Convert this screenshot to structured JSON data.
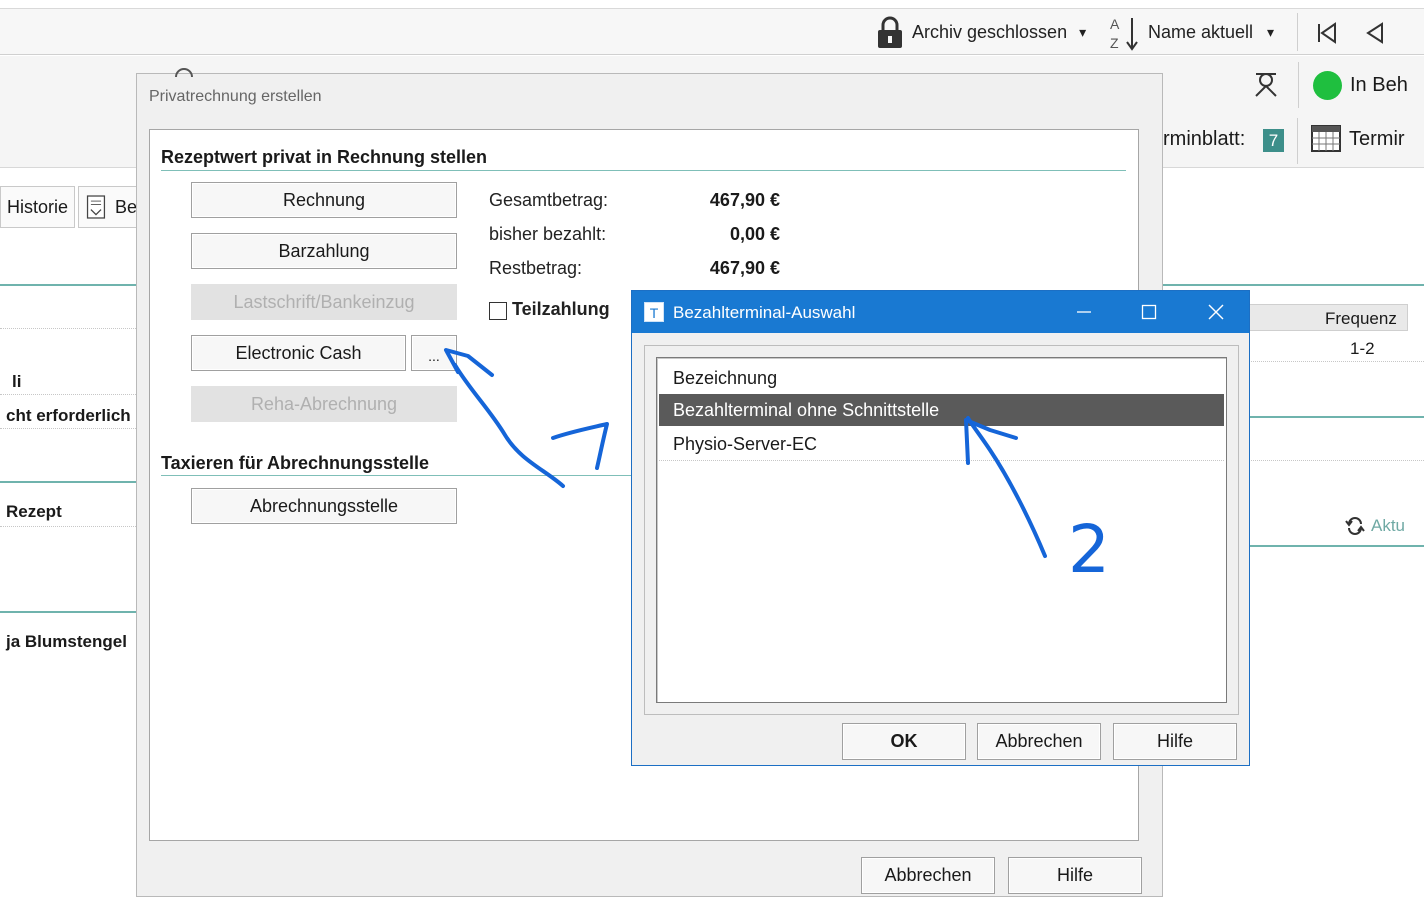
{
  "topbar": {
    "archive_label": "Archiv geschlossen",
    "sort_label": "Name aktuell",
    "caret": "▾"
  },
  "status": {
    "in_treatment": "In Beh",
    "appointment_sheet": "rminblatt:",
    "appointment_day": "7",
    "appointment_label": "Termir"
  },
  "background": {
    "tab_history": "Historie",
    "tab_b": "Be",
    "text_li": "li",
    "text_required": "cht erforderlich",
    "text_rezept": "Rezept",
    "text_blumstengel": "ja Blumstengel",
    "col_frequency": "Frequenz",
    "frequency_value": "1-2",
    "refresh_label": "Aktu"
  },
  "dialog": {
    "title": "Privatrechnung erstellen",
    "section1_title": "Rezeptwert privat in Rechnung stellen",
    "btn_invoice": "Rechnung",
    "btn_cash": "Barzahlung",
    "btn_debit": "Lastschrift/Bankeinzug",
    "btn_ec": "Electronic Cash",
    "btn_more": "...",
    "btn_reha": "Reha-Abrechnung",
    "total_label": "Gesamtbetrag:",
    "total_value": "467,90 €",
    "paid_label": "bisher bezahlt:",
    "paid_value": "0,00 €",
    "rest_label": "Restbetrag:",
    "rest_value": "467,90 €",
    "partial_label": "Teilzahlung",
    "section2_title": "Taxieren für Abrechnungsstelle",
    "btn_billing_office": "Abrechnungsstelle",
    "btn_cancel": "Abbrechen",
    "btn_help": "Hilfe"
  },
  "terminal_dialog": {
    "title": "Bezahlterminal-Auswahl",
    "app_icon_letter": "T",
    "column_header": "Bezeichnung",
    "items": [
      {
        "label": "Bezahlterminal ohne Schnittstelle",
        "selected": true
      },
      {
        "label": "Physio-Server-EC",
        "selected": false
      }
    ],
    "btn_ok": "OK",
    "btn_cancel": "Abbrechen",
    "btn_help": "Hilfe"
  },
  "annotation": {
    "number": "2",
    "color": "#1565d8"
  },
  "colors": {
    "accent_teal": "#6fb3ad",
    "titlebar_blue": "#1979d2",
    "selection": "#5a5a5a",
    "green_status": "#1fbf3f",
    "calendar_teal": "#3d8f8a"
  }
}
